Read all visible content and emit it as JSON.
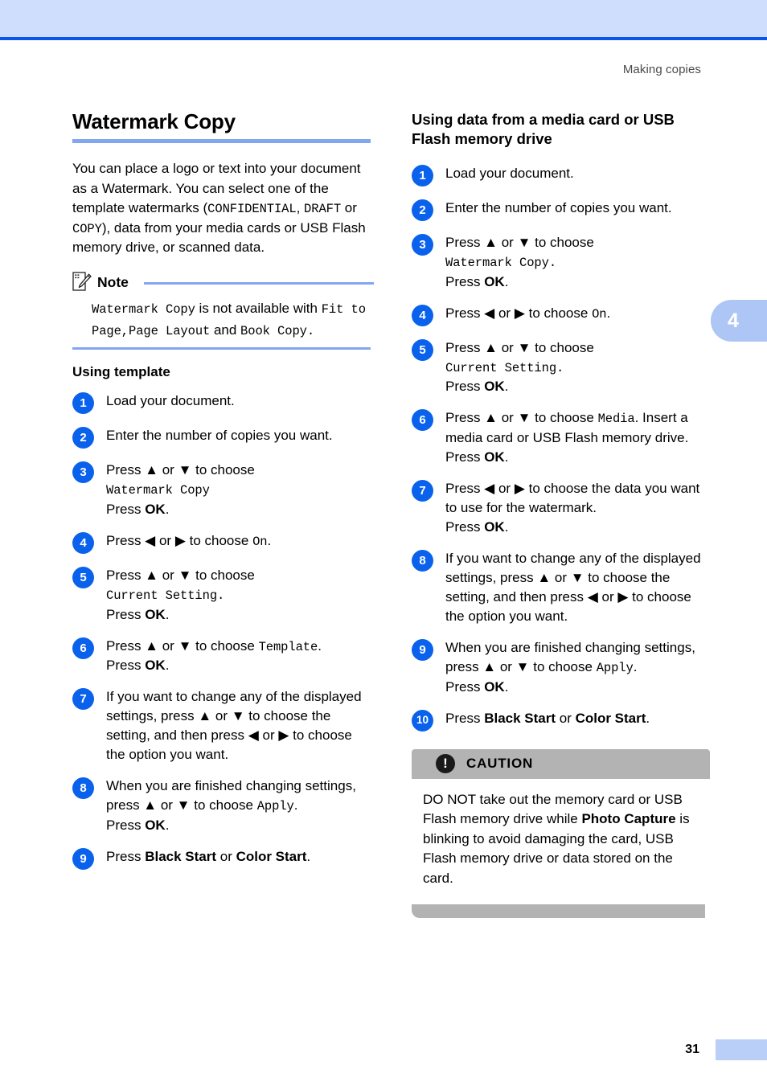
{
  "header": {
    "running_title": "Making copies"
  },
  "chapter_tab": {
    "number": "4"
  },
  "footer": {
    "page_number": "31"
  },
  "left_column": {
    "title": "Watermark Copy",
    "intro_parts": {
      "p1": "You can place a logo or text into your document as a Watermark. You can select one of the template watermarks (",
      "mono1": "CONFIDENTIAL",
      "sep1": ", ",
      "mono2": "DRAFT",
      "sep2": " or ",
      "mono3": "COPY",
      "p2": "), data from your media cards or USB Flash memory drive, or scanned data."
    },
    "note": {
      "title": "Note",
      "mono1": "Watermark Copy",
      "text1": " is not available with ",
      "mono2": "Fit to Page,Page Layout",
      "text2": " and ",
      "mono3": "Book Copy."
    },
    "subheading": "Using template",
    "steps": [
      {
        "num": "1",
        "lines": [
          {
            "type": "plain",
            "text": "Load your document."
          }
        ]
      },
      {
        "num": "2",
        "lines": [
          {
            "type": "plain",
            "text": "Enter the number of copies you want."
          }
        ]
      },
      {
        "num": "3",
        "lines": [
          {
            "type": "plain",
            "text": "Press ▲ or ▼ to choose"
          },
          {
            "type": "mono",
            "text": "Watermark Copy"
          },
          {
            "type": "press-ok",
            "text": "Press OK."
          }
        ]
      },
      {
        "num": "4",
        "lines": [
          {
            "type": "mixed",
            "pre": "Press ◀ or ▶ to choose ",
            "mono": "On",
            "post": "."
          }
        ]
      },
      {
        "num": "5",
        "lines": [
          {
            "type": "plain",
            "text": "Press ▲ or ▼ to choose"
          },
          {
            "type": "mono",
            "text": "Current Setting."
          },
          {
            "type": "press-ok",
            "text": "Press OK."
          }
        ]
      },
      {
        "num": "6",
        "lines": [
          {
            "type": "mixed",
            "pre": "Press ▲ or ▼ to choose ",
            "mono": "Template",
            "post": "."
          },
          {
            "type": "press-ok",
            "text": "Press OK."
          }
        ]
      },
      {
        "num": "7",
        "lines": [
          {
            "type": "plain",
            "text": "If you want to change any of the displayed settings, press ▲ or ▼ to choose the setting, and then press ◀ or ▶ to choose the option you want."
          }
        ]
      },
      {
        "num": "8",
        "lines": [
          {
            "type": "mixed",
            "pre": "When you are finished changing settings, press ▲ or ▼ to choose ",
            "mono": "Apply",
            "post": "."
          },
          {
            "type": "press-ok",
            "text": "Press OK."
          }
        ]
      },
      {
        "num": "9",
        "lines": [
          {
            "type": "press-start",
            "pre": "Press ",
            "b1": "Black Start",
            "mid": " or ",
            "b2": "Color Start",
            "post": "."
          }
        ]
      }
    ]
  },
  "right_column": {
    "subheading": "Using data from a media card or USB Flash memory drive",
    "steps": [
      {
        "num": "1",
        "lines": [
          {
            "type": "plain",
            "text": "Load your document."
          }
        ]
      },
      {
        "num": "2",
        "lines": [
          {
            "type": "plain",
            "text": "Enter the number of copies you want."
          }
        ]
      },
      {
        "num": "3",
        "lines": [
          {
            "type": "plain",
            "text": "Press ▲ or ▼ to choose"
          },
          {
            "type": "mono",
            "text": "Watermark Copy."
          },
          {
            "type": "press-ok",
            "text": "Press OK."
          }
        ]
      },
      {
        "num": "4",
        "lines": [
          {
            "type": "mixed",
            "pre": "Press ◀ or ▶ to choose ",
            "mono": "On",
            "post": "."
          }
        ]
      },
      {
        "num": "5",
        "lines": [
          {
            "type": "plain",
            "text": "Press ▲ or ▼ to choose"
          },
          {
            "type": "mono",
            "text": "Current Setting."
          },
          {
            "type": "press-ok",
            "text": "Press OK."
          }
        ]
      },
      {
        "num": "6",
        "lines": [
          {
            "type": "mixed",
            "pre": "Press ▲ or ▼ to choose ",
            "mono": "Media",
            "post": ". Insert a media card or USB Flash memory drive."
          },
          {
            "type": "press-ok",
            "text": "Press OK."
          }
        ]
      },
      {
        "num": "7",
        "lines": [
          {
            "type": "plain",
            "text": "Press ◀ or ▶ to choose the data you want to use for the watermark."
          },
          {
            "type": "press-ok",
            "text": "Press OK."
          }
        ]
      },
      {
        "num": "8",
        "lines": [
          {
            "type": "plain",
            "text": "If you want to change any of the displayed settings, press ▲ or ▼ to choose the setting, and then press ◀ or ▶ to choose the option you want."
          }
        ]
      },
      {
        "num": "9",
        "lines": [
          {
            "type": "mixed",
            "pre": "When you are finished changing settings, press ▲ or ▼ to choose ",
            "mono": "Apply",
            "post": "."
          },
          {
            "type": "press-ok",
            "text": "Press OK."
          }
        ]
      },
      {
        "num": "10",
        "lines": [
          {
            "type": "press-start",
            "pre": "Press ",
            "b1": "Black Start",
            "mid": " or ",
            "b2": "Color Start",
            "post": "."
          }
        ]
      }
    ],
    "caution": {
      "title": "CAUTION",
      "icon_glyph": "!",
      "pre": "DO NOT take out the memory card or USB Flash memory drive while ",
      "bold": "Photo Capture",
      "post": " is blinking to avoid damaging the card, USB Flash memory drive or data stored on the card."
    }
  },
  "colors": {
    "band_blue": "#cfdefc",
    "rule_blue": "#0a54f0",
    "heading_rule": "#82a6f0",
    "step_circle": "#0a62ec",
    "tab_blue": "#aec6f5",
    "caution_gray": "#b3b3b3"
  }
}
